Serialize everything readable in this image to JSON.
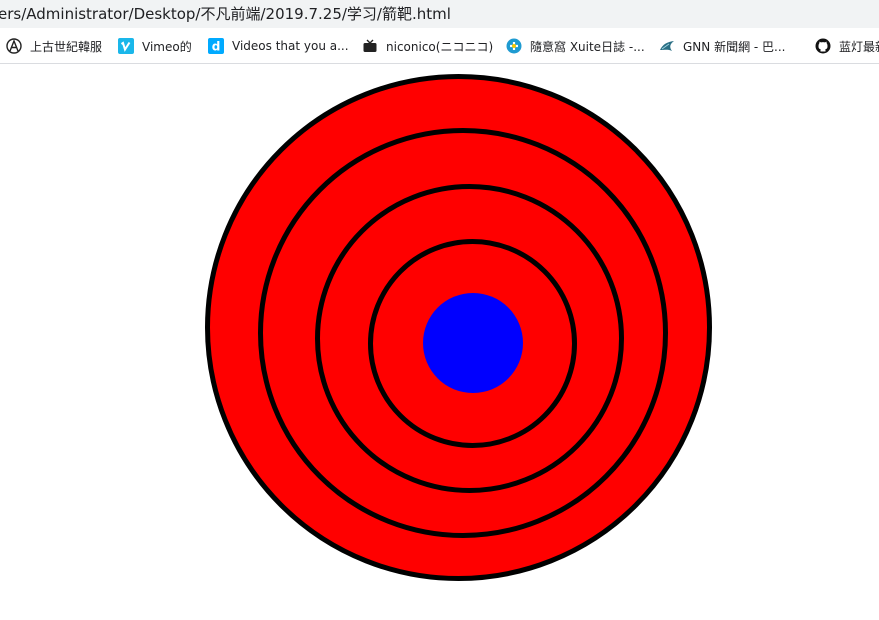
{
  "address_bar": {
    "url_text": "ers/Administrator/Desktop/不凡前端/2019.7.25/学习/箭靶.html"
  },
  "bookmarks": [
    {
      "label": "上古世紀韓服",
      "icon": "anarchy-logo-icon"
    },
    {
      "label": "Vimeo的",
      "icon": "vimeo-icon"
    },
    {
      "label": "Videos that you a...",
      "icon": "dailymotion-icon"
    },
    {
      "label": "niconico(ニコニコ)",
      "icon": "niconico-tv-icon"
    },
    {
      "label": "隨意窩 Xuite日誌 -...",
      "icon": "xuite-icon"
    },
    {
      "label": "GNN 新聞網 - 巴...",
      "icon": "gamer-dragon-icon"
    },
    {
      "label": "蓝灯最新",
      "icon": "github-icon"
    }
  ],
  "colors": {
    "ring_fill": "#ff0000",
    "ring_stroke": "#000000",
    "bullseye_fill": "#0000ff",
    "page_bg": "#ffffff"
  }
}
